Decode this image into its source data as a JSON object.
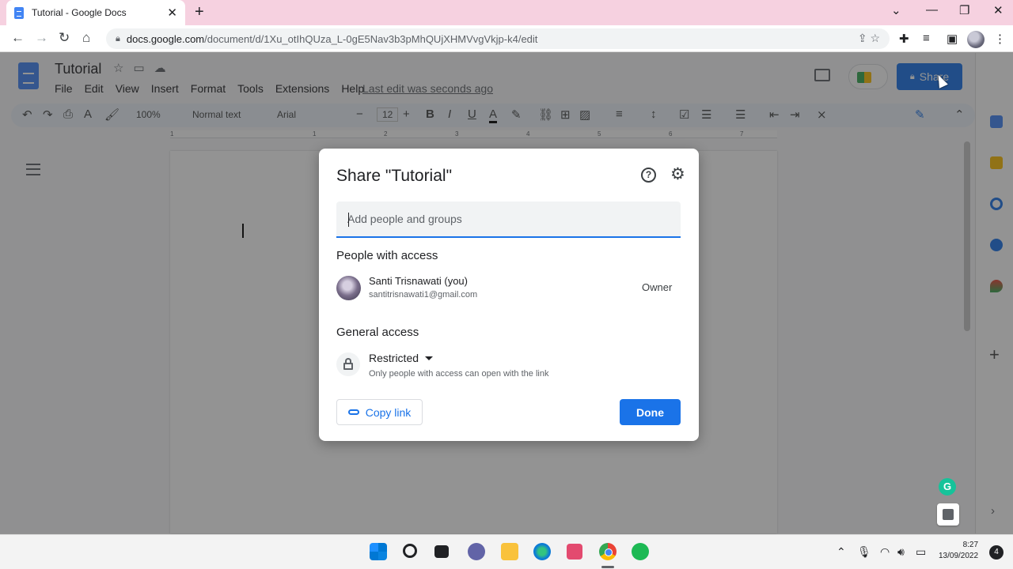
{
  "browser": {
    "tab_title": "Tutorial - Google Docs",
    "tab_close": "✕",
    "new_tab": "+",
    "url_host": "docs.google.com",
    "url_path": "/document/d/1Xu_otIhQUza_L-0gE5Nav3b3pMhQUjXHMVvgVkjp-k4/edit",
    "window_controls": [
      "⌄",
      "—",
      "❐",
      "✕"
    ]
  },
  "docs": {
    "title": "Tutorial",
    "menu": [
      "File",
      "Edit",
      "View",
      "Insert",
      "Format",
      "Tools",
      "Extensions",
      "Help"
    ],
    "last_edit": "Last edit was seconds ago",
    "share_label": "Share",
    "toolbar": {
      "zoom": "100%",
      "style": "Normal text",
      "font": "Arial",
      "font_size": "12"
    },
    "ruler_numbers": [
      "1",
      "1",
      "2",
      "3",
      "4",
      "5",
      "6",
      "7"
    ]
  },
  "dialog": {
    "title": "Share \"Tutorial\"",
    "input_placeholder": "Add people and groups",
    "people_header": "People with access",
    "person": {
      "name": "Santi Trisnawati (you)",
      "email": "santitrisnawati1@gmail.com",
      "role": "Owner"
    },
    "general_header": "General access",
    "access_level": "Restricted",
    "access_desc": "Only people with access can open with the link",
    "copy_link_label": "Copy link",
    "done_label": "Done"
  },
  "taskbar": {
    "time": "8:27",
    "date": "13/09/2022",
    "notifications": "4"
  },
  "colors": {
    "accent": "#1a73e8",
    "tabstrip": "#f6d1e0"
  }
}
